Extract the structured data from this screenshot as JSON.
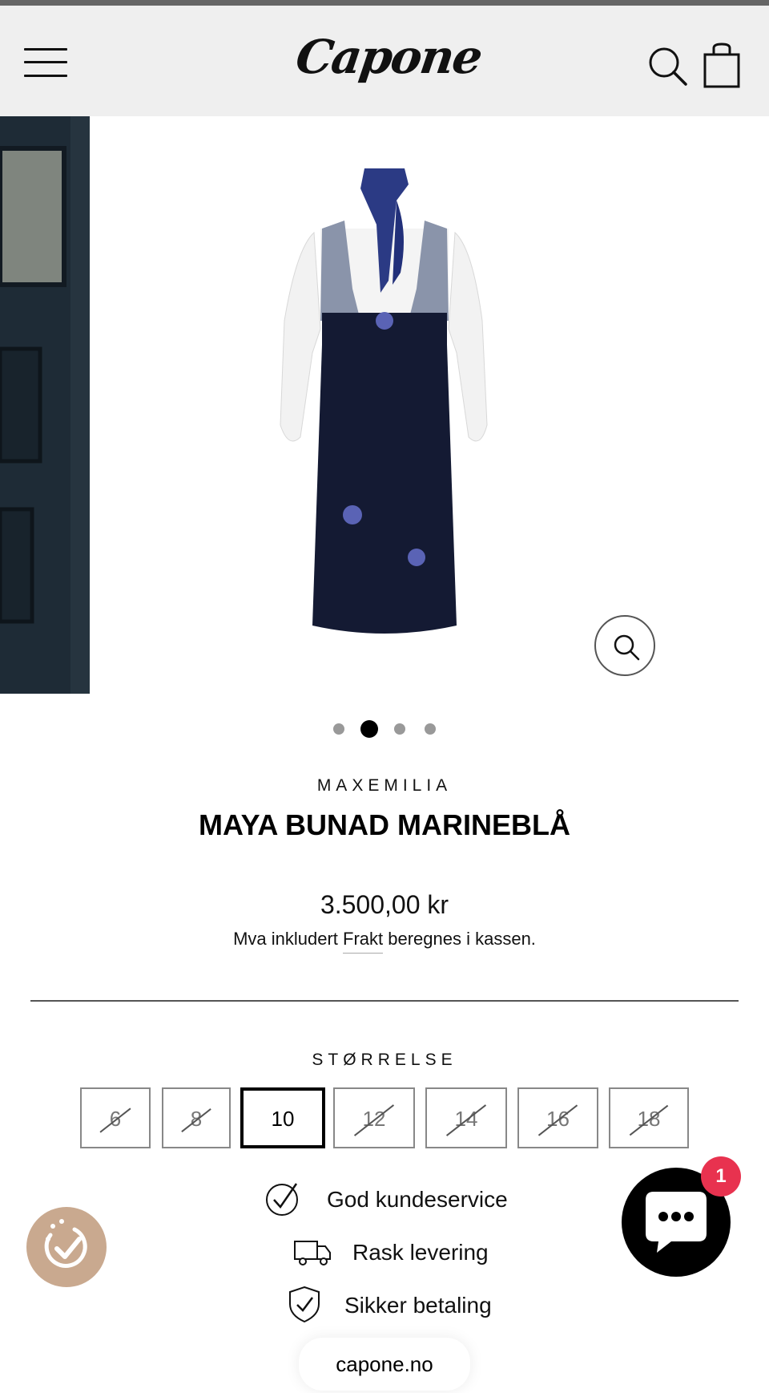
{
  "header": {
    "logo_text": "Capone",
    "menu_icon": "hamburger-menu-icon",
    "search_icon": "search-icon",
    "cart_icon": "shopping-bag-icon"
  },
  "gallery": {
    "image_count": 4,
    "active_index": 1,
    "zoom_icon": "magnifier-icon"
  },
  "product": {
    "brand": "MAXEMILIA",
    "title": "MAYA BUNAD MARINEBLÅ",
    "price": "3.500,00 kr",
    "tax_prefix": "Mva inkludert ",
    "tax_link": "Frakt",
    "tax_suffix": " beregnes i kassen."
  },
  "size_selector": {
    "label": "STØRRELSE",
    "options": [
      {
        "value": "6",
        "available": false,
        "selected": false
      },
      {
        "value": "8",
        "available": false,
        "selected": false
      },
      {
        "value": "10",
        "available": true,
        "selected": true
      },
      {
        "value": "12",
        "available": false,
        "selected": false
      },
      {
        "value": "14",
        "available": false,
        "selected": false
      },
      {
        "value": "16",
        "available": false,
        "selected": false
      },
      {
        "value": "18",
        "available": false,
        "selected": false
      }
    ]
  },
  "features": [
    {
      "icon": "checkmark-circle-icon",
      "label": "God kundeservice"
    },
    {
      "icon": "delivery-truck-icon",
      "label": "Rask levering"
    },
    {
      "icon": "shield-check-icon",
      "label": "Sikker betaling"
    }
  ],
  "chat": {
    "badge_count": "1",
    "icon": "chat-bubble-icon"
  },
  "rewards": {
    "icon": "rewards-badge-icon"
  },
  "browser": {
    "url": "capone.no"
  },
  "colors": {
    "header_bg": "#efefef",
    "badge": "#e8324f",
    "rewards_bg": "#c9a98f",
    "accent": "#000000"
  }
}
